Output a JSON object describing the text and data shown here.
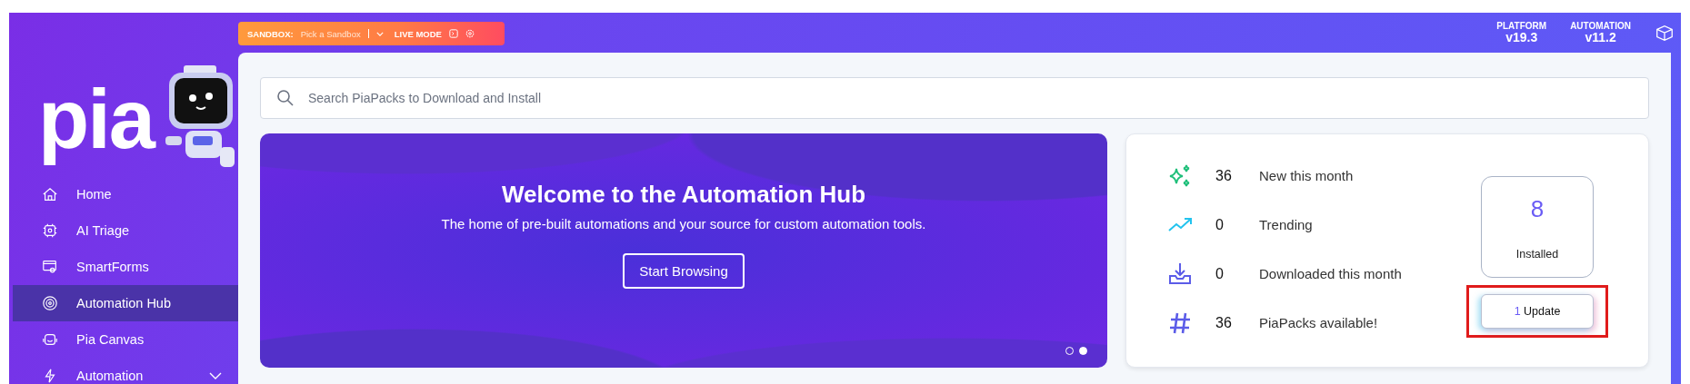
{
  "top_bar": {
    "sandbox_label": "SANDBOX:",
    "sandbox_placeholder": "Pick a Sandbox",
    "mode_label": "LIVE MODE",
    "versions": [
      {
        "label": "PLATFORM",
        "value": "v19.3"
      },
      {
        "label": "AUTOMATION",
        "value": "v11.2"
      }
    ]
  },
  "sidebar": {
    "logo": "pia",
    "items": [
      {
        "label": "Home",
        "selected": false,
        "expandable": false
      },
      {
        "label": "AI Triage",
        "selected": false,
        "expandable": false
      },
      {
        "label": "SmartForms",
        "selected": false,
        "expandable": false
      },
      {
        "label": "Automation Hub",
        "selected": true,
        "expandable": false
      },
      {
        "label": "Pia Canvas",
        "selected": false,
        "expandable": false
      },
      {
        "label": "Automation",
        "selected": false,
        "expandable": true
      }
    ]
  },
  "search": {
    "placeholder": "Search PiaPacks to Download and Install"
  },
  "banner": {
    "title": "Welcome to the Automation Hub",
    "subtitle": "The home of pre-built automations and your source for custom automation tools.",
    "button": "Start Browsing",
    "dots": [
      {
        "selected": false
      },
      {
        "selected": true
      }
    ]
  },
  "stats": [
    {
      "kind": "sparkle",
      "count": "36",
      "label": "New this month"
    },
    {
      "kind": "trend",
      "count": "0",
      "label": "Trending"
    },
    {
      "kind": "download",
      "count": "0",
      "label": "Downloaded this month"
    },
    {
      "kind": "hash",
      "count": "36",
      "label": "PiaPacks available!"
    }
  ],
  "installed": {
    "count": "8",
    "label": "Installed"
  },
  "update_button": {
    "count": "1",
    "label": "Update",
    "highlighted": true
  }
}
